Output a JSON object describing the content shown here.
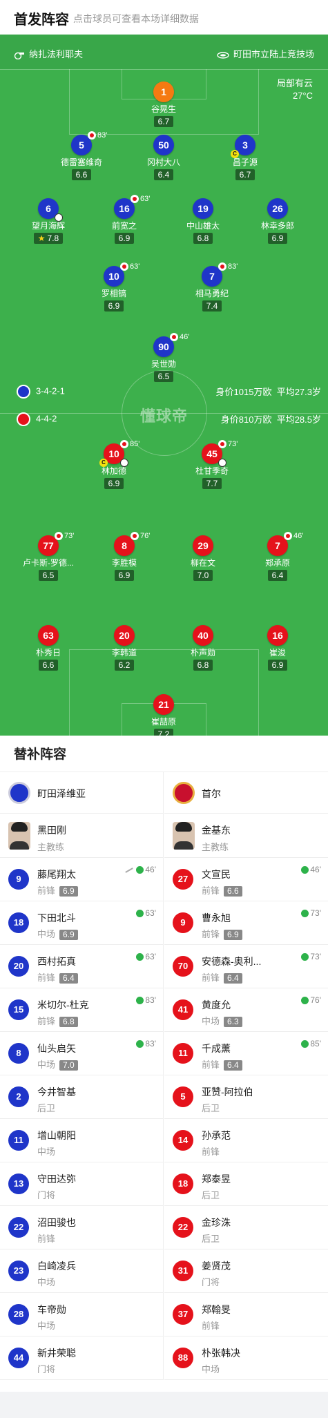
{
  "header": {
    "title": "首发阵容",
    "subtitle": "点击球员可查看本场详细数据"
  },
  "venue": {
    "referee": "纳扎法利耶夫",
    "stadium": "町田市立陆上竞技场"
  },
  "weather": {
    "condition": "局部有云",
    "temp": "27°C"
  },
  "watermark": "懂球帝",
  "home_team": {
    "formation": "3-4-2-1",
    "value": "身价1015万欧",
    "age": "平均27.3岁",
    "color": "#1f35c9"
  },
  "away_team": {
    "formation": "4-4-2",
    "value": "身价810万欧",
    "age": "平均28.5岁",
    "color": "#e5121b"
  },
  "home_players": [
    {
      "num": "1",
      "name": "谷晃生",
      "rating": "6.7",
      "color": "orange"
    },
    {
      "num": "5",
      "name": "德雷塞维奇",
      "rating": "6.6",
      "sub": "83'"
    },
    {
      "num": "50",
      "name": "冈村大八",
      "rating": "6.4"
    },
    {
      "num": "3",
      "name": "昌子源",
      "rating": "6.7",
      "captain": "C"
    },
    {
      "num": "6",
      "name": "望月海辉",
      "rating": "7.8",
      "star": true,
      "ball": true
    },
    {
      "num": "16",
      "name": "前宽之",
      "rating": "6.9",
      "sub": "63'"
    },
    {
      "num": "19",
      "name": "中山雄太",
      "rating": "6.8"
    },
    {
      "num": "26",
      "name": "林幸多郎",
      "rating": "6.9"
    },
    {
      "num": "10",
      "name": "罗相镐",
      "rating": "6.9",
      "sub": "63'"
    },
    {
      "num": "7",
      "name": "相马勇纪",
      "rating": "7.4",
      "sub": "83'"
    },
    {
      "num": "90",
      "name": "吴世勋",
      "rating": "6.5",
      "sub": "46'"
    }
  ],
  "away_players": [
    {
      "num": "10",
      "name": "林加德",
      "rating": "6.9",
      "sub": "85'",
      "captain": "C",
      "ball": true
    },
    {
      "num": "45",
      "name": "杜甘季奇",
      "rating": "7.7",
      "sub": "73'",
      "ball": true
    },
    {
      "num": "77",
      "name": "卢卡斯-罗德...",
      "rating": "6.5",
      "sub": "73'"
    },
    {
      "num": "8",
      "name": "李胜模",
      "rating": "6.9",
      "sub": "76'"
    },
    {
      "num": "29",
      "name": "柳在文",
      "rating": "7.0"
    },
    {
      "num": "7",
      "name": "郑承原",
      "rating": "6.4",
      "sub": "46'"
    },
    {
      "num": "63",
      "name": "朴秀日",
      "rating": "6.6"
    },
    {
      "num": "20",
      "name": "李韩道",
      "rating": "6.2"
    },
    {
      "num": "40",
      "name": "朴声勋",
      "rating": "6.8"
    },
    {
      "num": "16",
      "name": "崔浚",
      "rating": "6.9"
    },
    {
      "num": "21",
      "name": "崔喆原",
      "rating": "7.2"
    }
  ],
  "subs": {
    "title": "替补阵容",
    "home": {
      "team": "町田泽维亚",
      "coach": "黑田刚",
      "coach_role": "主教练",
      "players": [
        {
          "num": "9",
          "name": "藤尾翔太",
          "role": "前锋",
          "rating": "6.9",
          "min": "46'",
          "kick": true
        },
        {
          "num": "18",
          "name": "下田北斗",
          "role": "中场",
          "rating": "6.9",
          "min": "63'"
        },
        {
          "num": "20",
          "name": "西村拓真",
          "role": "前锋",
          "rating": "6.4",
          "min": "63'"
        },
        {
          "num": "15",
          "name": "米切尔-杜克",
          "role": "前锋",
          "rating": "6.8",
          "min": "83'"
        },
        {
          "num": "8",
          "name": "仙头启矢",
          "role": "中场",
          "rating": "7.0",
          "min": "83'"
        },
        {
          "num": "2",
          "name": "今井智基",
          "role": "后卫"
        },
        {
          "num": "11",
          "name": "增山朝阳",
          "role": "中场"
        },
        {
          "num": "13",
          "name": "守田达弥",
          "role": "门将"
        },
        {
          "num": "22",
          "name": "沼田骏也",
          "role": "前锋"
        },
        {
          "num": "23",
          "name": "白崎凌兵",
          "role": "中场"
        },
        {
          "num": "28",
          "name": "车帝勋",
          "role": "中场"
        },
        {
          "num": "44",
          "name": "新井荣聪",
          "role": "门将"
        }
      ]
    },
    "away": {
      "team": "首尔",
      "coach": "金基东",
      "coach_role": "主教练",
      "players": [
        {
          "num": "27",
          "name": "文宣民",
          "role": "前锋",
          "rating": "6.6",
          "min": "46'"
        },
        {
          "num": "9",
          "name": "曹永旭",
          "role": "前锋",
          "rating": "6.9",
          "min": "73'"
        },
        {
          "num": "70",
          "name": "安德森-奥利...",
          "role": "前锋",
          "rating": "6.4",
          "min": "73'"
        },
        {
          "num": "41",
          "name": "黄度允",
          "role": "中场",
          "rating": "6.3",
          "min": "76'"
        },
        {
          "num": "11",
          "name": "千成薰",
          "role": "前锋",
          "rating": "6.4",
          "min": "85'"
        },
        {
          "num": "5",
          "name": "亚赞-阿拉伯",
          "role": "后卫"
        },
        {
          "num": "14",
          "name": "孙承范",
          "role": "前锋"
        },
        {
          "num": "18",
          "name": "郑泰昱",
          "role": "后卫"
        },
        {
          "num": "22",
          "name": "金珍洙",
          "role": "后卫"
        },
        {
          "num": "31",
          "name": "姜贤茂",
          "role": "门将"
        },
        {
          "num": "37",
          "name": "郑翰旻",
          "role": "前锋"
        },
        {
          "num": "88",
          "name": "朴张韩决",
          "role": "中场"
        }
      ]
    }
  }
}
